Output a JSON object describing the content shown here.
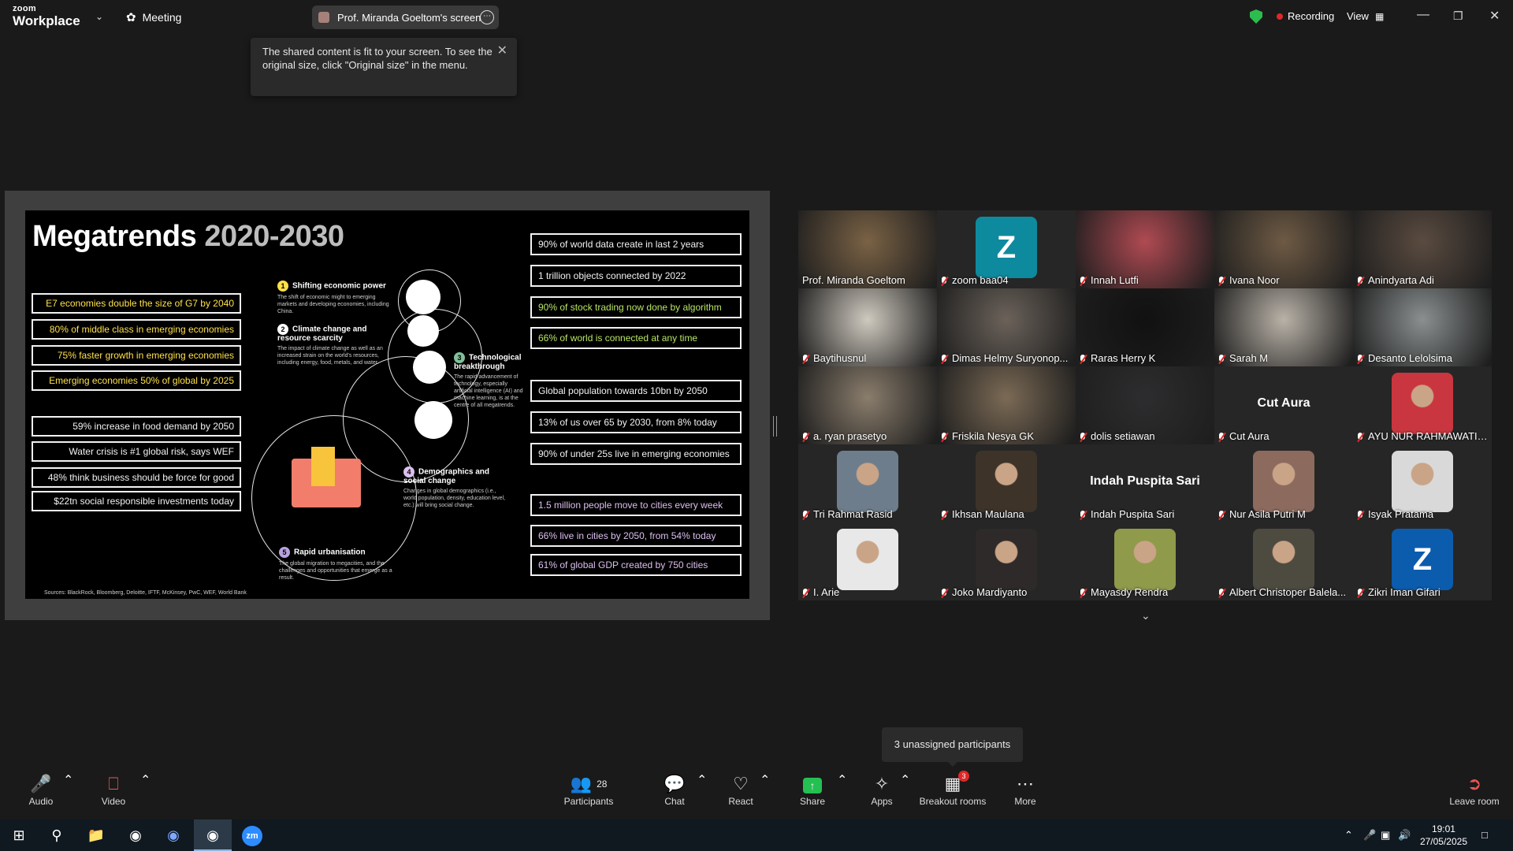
{
  "topbar": {
    "logo_line1": "zoom",
    "logo_line2": "Workplace",
    "meeting_label": "Meeting",
    "screen_label": "Prof. Miranda Goeltom's screen",
    "recording_label": "Recording",
    "view_label": "View"
  },
  "tooltip": {
    "text": "The shared content is fit to your screen. To see the original size, click \"Original size\" in the menu."
  },
  "slide": {
    "title_main": "Megatrends ",
    "title_years": "2020-2030",
    "left_items": [
      "E7 economies double the size of G7 by 2040",
      "80% of middle class in emerging economies",
      "75% faster growth in emerging economies",
      "Emerging economies 50% of global by 2025",
      "59% increase in food demand by 2050",
      "Water crisis is #1 global risk, says WEF",
      "48% think business should be force for good",
      "$22tn social responsible investments today"
    ],
    "right_items": [
      "90% of world data create in last 2 years",
      "1 trillion objects connected by 2022",
      "90% of stock trading now done by algorithm",
      "66% of world is connected at any time",
      "Global population towards 10bn by 2050",
      "13% of us over 65 by 2030, from 8% today",
      "90% of under 25s live in emerging economies",
      "1.5 million people move to cities every week",
      "66% live in cities by 2050, from 54% today",
      "61% of global GDP created by 750 cities"
    ],
    "trends": [
      {
        "n": "1",
        "title": "Shifting economic power",
        "desc": "The shift of economic might to emerging markets and developing economies, including China."
      },
      {
        "n": "2",
        "title": "Climate change and resource scarcity",
        "desc": "The impact of climate change as well as an increased strain on the world's resources, including energy, food, metals, and water."
      },
      {
        "n": "3",
        "title": "Technological breakthrough",
        "desc": "The rapid advancement of technology, especially artificial intelligence (AI) and machine learning, is at the centre of all megatrends."
      },
      {
        "n": "4",
        "title": "Demographics and social change",
        "desc": "Changes in global demographics (i.e., world population, density, education level, etc.) will bring social change."
      },
      {
        "n": "5",
        "title": "Rapid urbanisation",
        "desc": "The global migration to megacities, and the challenges and opportunities that emerge as a result."
      }
    ],
    "sources": "Sources: BlackRock, Bloomberg, Deloitte, IFTF, McKinsey, PwC, WEF, World Bank"
  },
  "participants": [
    {
      "name": "Prof. Miranda Goeltom",
      "type": "video",
      "color": "#7a6245",
      "active": true
    },
    {
      "name": "zoom baa04",
      "type": "letter",
      "letter": "Z",
      "color": "#0e8a9e"
    },
    {
      "name": "Innah Lutfi",
      "type": "video",
      "color": "#b04a52"
    },
    {
      "name": "Ivana Noor",
      "type": "video",
      "color": "#6e5a44"
    },
    {
      "name": "Anindyarta Adi",
      "type": "video",
      "color": "#5a4b40"
    },
    {
      "name": "Baytihusnul",
      "type": "video",
      "color": "#cfc9bf"
    },
    {
      "name": "Dimas Helmy Suryonop...",
      "type": "video",
      "color": "#6b625a"
    },
    {
      "name": "Raras Herry K",
      "type": "video",
      "color": "#111111"
    },
    {
      "name": "Sarah M",
      "type": "video",
      "color": "#b9b2a8"
    },
    {
      "name": "Desanto Lelolsima",
      "type": "video",
      "color": "#8a8f90"
    },
    {
      "name": "a. ryan prasetyo",
      "type": "video",
      "color": "#8a7d6c"
    },
    {
      "name": "Friskila Nesya GK",
      "type": "video",
      "color": "#7b6a55"
    },
    {
      "name": "dolis setiawan",
      "type": "video",
      "color": "#2d2d2f"
    },
    {
      "name": "Cut Aura",
      "type": "text",
      "big": "Cut Aura"
    },
    {
      "name": "AYU NUR RAHMAWATI, ...",
      "type": "photo",
      "color": "#c9363f"
    },
    {
      "name": "Tri Rahmat Rasid",
      "type": "photo",
      "color": "#6d7d8c"
    },
    {
      "name": "Ikhsan Maulana",
      "type": "photo",
      "color": "#3d3329"
    },
    {
      "name": "Indah Puspita Sari",
      "type": "text",
      "big": "Indah Puspita Sari"
    },
    {
      "name": "Nur Asila Putri M",
      "type": "photo",
      "color": "#8c6a5e"
    },
    {
      "name": "Isyak Pratama",
      "type": "photo",
      "color": "#d9d9d9"
    },
    {
      "name": "I. Arie",
      "type": "photo",
      "color": "#e8e8e8"
    },
    {
      "name": "Joko Mardiyanto",
      "type": "photo",
      "color": "#2e2a2a"
    },
    {
      "name": "Mayasdy Rendra",
      "type": "photo",
      "color": "#8f9a4a"
    },
    {
      "name": "Albert Christoper Balela...",
      "type": "photo",
      "color": "#4d4a40"
    },
    {
      "name": "Zikri Iman Gifari",
      "type": "letter",
      "letter": "Z",
      "color": "#0b5cad"
    }
  ],
  "unassigned": "3 unassigned participants",
  "toolbar": {
    "audio": "Audio",
    "video": "Video",
    "participants": "Participants",
    "participants_count": "28",
    "chat": "Chat",
    "react": "React",
    "share": "Share",
    "apps": "Apps",
    "breakout": "Breakout rooms",
    "breakout_badge": "3",
    "more": "More",
    "leave": "Leave room"
  },
  "taskbar": {
    "time": "19:01",
    "date": "27/05/2025",
    "zoom_app_label": "zm"
  },
  "icons": [
    "audio-muted-icon",
    "video-off-icon",
    "participants-icon",
    "chat-icon",
    "react-heart-icon",
    "share-arrow-icon",
    "apps-icon",
    "breakout-grid-icon",
    "more-dots-icon",
    "leave-icon",
    "shield-icon",
    "windows-start-icon",
    "search-icon",
    "file-explorer-icon",
    "chrome-icon"
  ]
}
